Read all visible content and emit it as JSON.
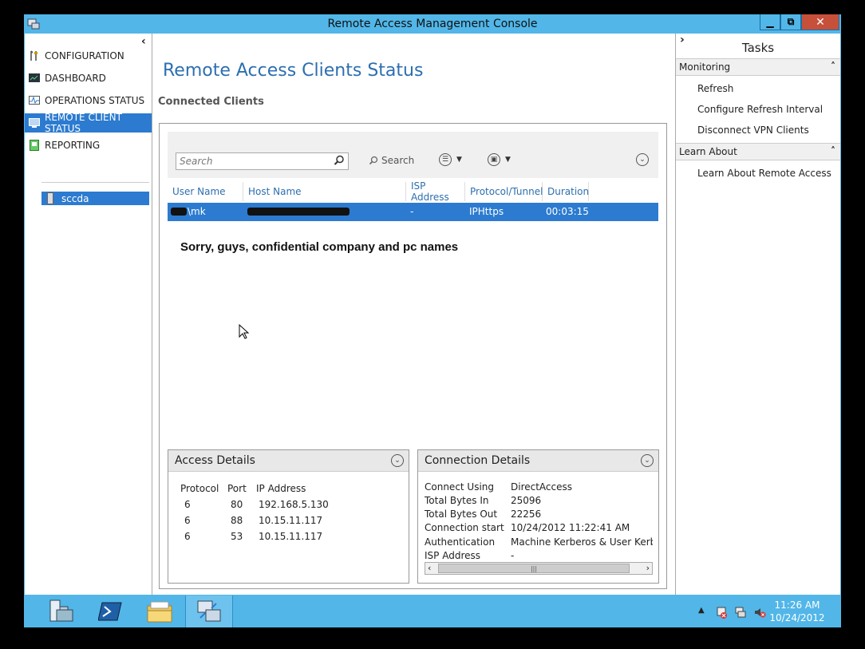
{
  "window": {
    "title": "Remote Access Management Console",
    "minimize_glyph": "▁",
    "maximize_glyph": "⧉",
    "close_glyph": "✕",
    "accent": "#52b6e8",
    "selection_color": "#2c7bd0"
  },
  "nav": {
    "collapse_glyph": "‹",
    "items": [
      {
        "label": "CONFIGURATION",
        "icon": "wrench-icon"
      },
      {
        "label": "DASHBOARD",
        "icon": "dashboard-icon"
      },
      {
        "label": "OPERATIONS STATUS",
        "icon": "pulse-icon"
      },
      {
        "label": "REMOTE CLIENT STATUS",
        "icon": "monitor-icon"
      },
      {
        "label": "REPORTING",
        "icon": "report-icon"
      }
    ],
    "server": "sccda"
  },
  "main": {
    "page_title": "Remote Access Clients Status",
    "section_title": "Connected Clients",
    "search": {
      "placeholder": "Search",
      "button_label": "Search"
    },
    "columns": [
      "User Name",
      "Host Name",
      "ISP Address",
      "Protocol/Tunnel",
      "Duration"
    ],
    "rows": [
      {
        "user": "\\mk",
        "host": "",
        "isp": "-",
        "protocol": "IPHttps",
        "duration": "00:03:15"
      }
    ],
    "note": "Sorry, guys, confidential company and pc names",
    "access_details": {
      "title": "Access Details",
      "headers": [
        "Protocol",
        "Port",
        "IP Address"
      ],
      "rows": [
        [
          "6",
          "80",
          "192.168.5.130"
        ],
        [
          "6",
          "88",
          "10.15.11.117"
        ],
        [
          "6",
          "53",
          "10.15.11.117"
        ]
      ]
    },
    "connection_details": {
      "title": "Connection Details",
      "rows": [
        [
          "Connect Using",
          "DirectAccess"
        ],
        [
          "Total Bytes In",
          "25096"
        ],
        [
          "Total Bytes Out",
          "22256"
        ],
        [
          "Connection start",
          "10/24/2012 11:22:41 AM"
        ],
        [
          "Authentication",
          "Machine Kerberos & User Kerberc"
        ],
        [
          "ISP Address",
          "-"
        ]
      ]
    }
  },
  "tasks": {
    "title": "Tasks",
    "groups": [
      {
        "label": "Monitoring",
        "items": [
          "Refresh",
          "Configure Refresh Interval",
          "Disconnect VPN Clients"
        ]
      },
      {
        "label": "Learn About",
        "items": [
          "Learn About Remote Access"
        ]
      }
    ]
  },
  "taskbar": {
    "apps": [
      "server-manager-icon",
      "powershell-icon",
      "file-explorer-icon",
      "remote-access-console-icon"
    ],
    "time": "11:26 AM",
    "date": "10/24/2012"
  }
}
